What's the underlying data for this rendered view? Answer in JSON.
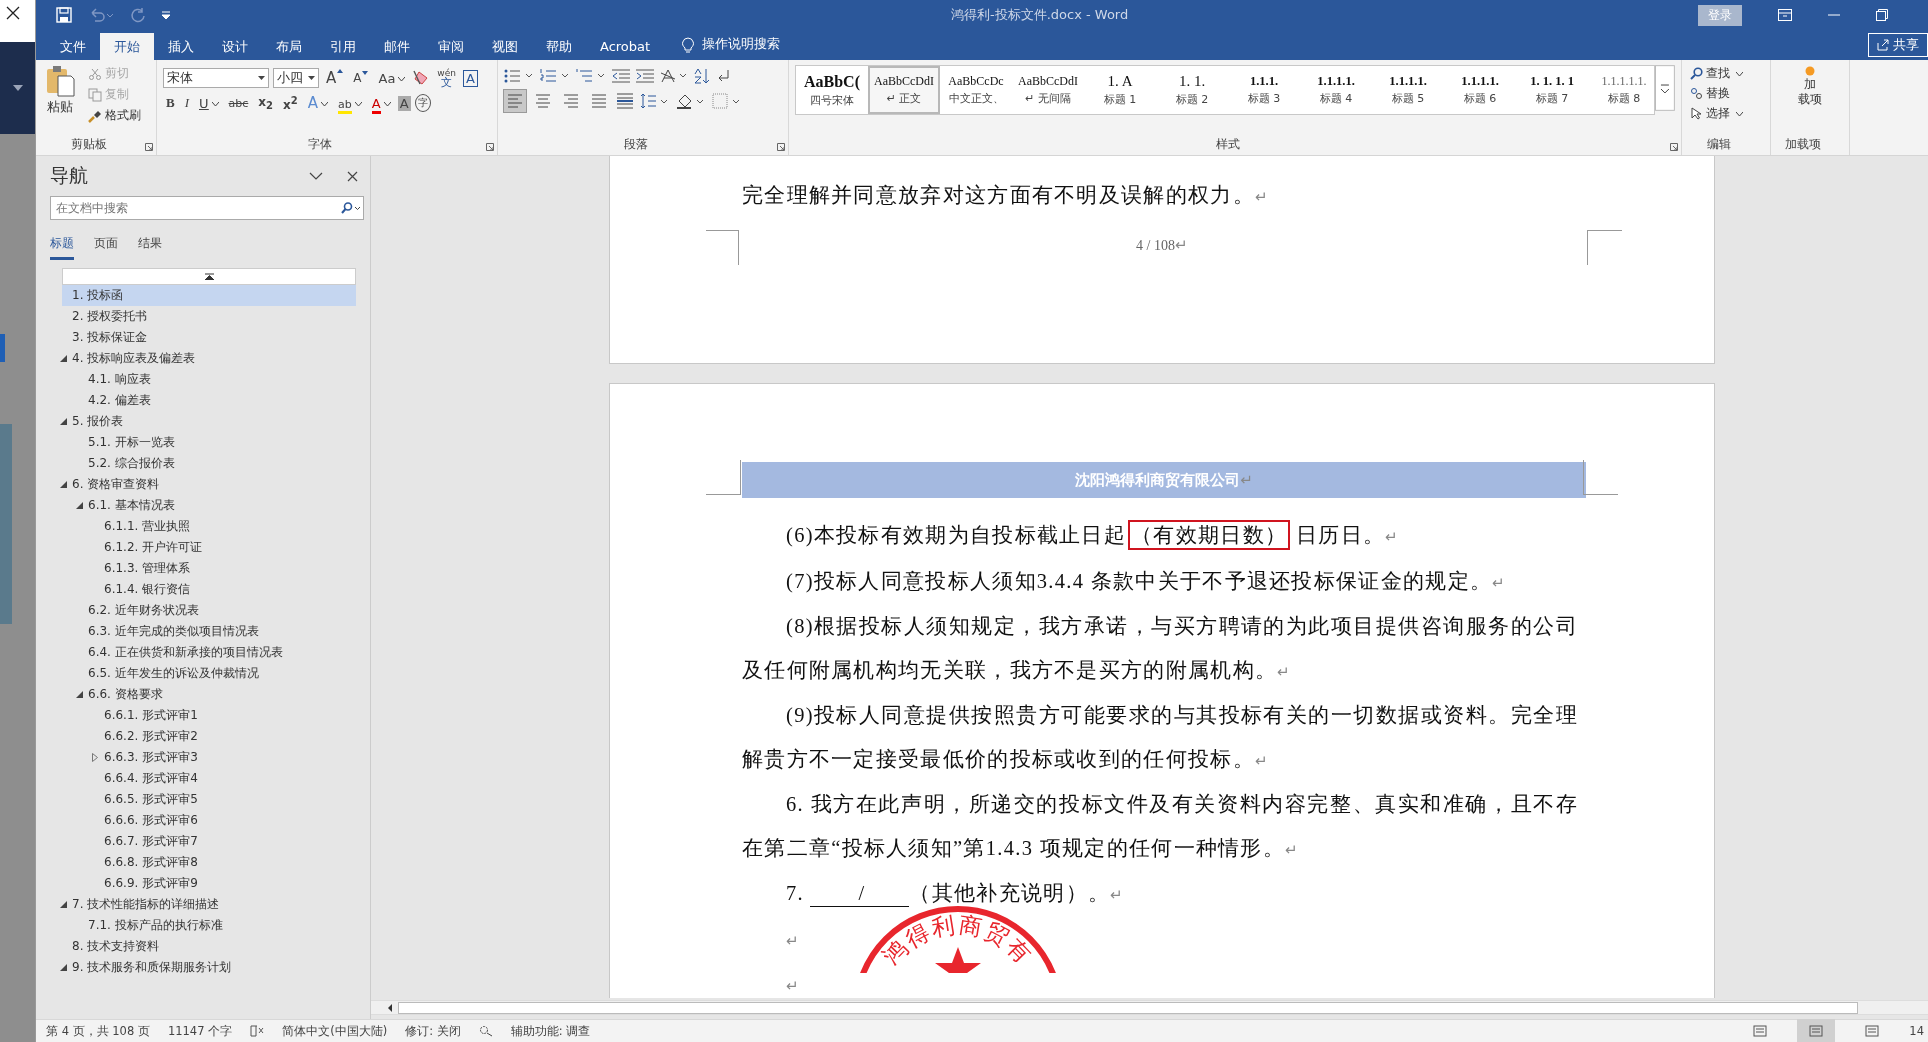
{
  "window": {
    "title": "鸿得利-投标文件.docx  -  Word",
    "sign_in": "登录",
    "share": "共享"
  },
  "ribbon_tabs": [
    {
      "label": "文件",
      "selected": false
    },
    {
      "label": "开始",
      "selected": true
    },
    {
      "label": "插入",
      "selected": false
    },
    {
      "label": "设计",
      "selected": false
    },
    {
      "label": "布局",
      "selected": false
    },
    {
      "label": "引用",
      "selected": false
    },
    {
      "label": "邮件",
      "selected": false
    },
    {
      "label": "审阅",
      "selected": false
    },
    {
      "label": "视图",
      "selected": false
    },
    {
      "label": "帮助",
      "selected": false
    },
    {
      "label": "Acrobat",
      "selected": false
    }
  ],
  "tell_me": "操作说明搜索",
  "clipboard": {
    "label": "剪贴板",
    "paste": "粘贴",
    "cut": {
      "label": "剪切",
      "disabled": true
    },
    "copy": {
      "label": "复制",
      "disabled": true
    },
    "format_painter": {
      "label": "格式刷",
      "disabled": false
    }
  },
  "font": {
    "label": "字体",
    "name": "宋体",
    "size": "小四",
    "tools": [
      {
        "kind": "grow",
        "label": "A"
      },
      {
        "kind": "shrink",
        "label": "A"
      },
      {
        "kind": "case",
        "label": "Aa"
      },
      {
        "kind": "clear"
      },
      {
        "kind": "phonetic",
        "top": "wén",
        "label": "文"
      },
      {
        "kind": "border",
        "label": "A"
      }
    ],
    "format": [
      {
        "kind": "bold",
        "label": "B"
      },
      {
        "kind": "italic",
        "label": "I"
      },
      {
        "kind": "underline",
        "label": "U"
      },
      {
        "kind": "strike",
        "label": "abc"
      },
      {
        "kind": "sub",
        "label": "x$_{2}$"
      },
      {
        "kind": "sup",
        "label": "x$^{2}$"
      },
      {
        "kind": "effects",
        "label": "A"
      },
      {
        "kind": "highlight",
        "label": "ab"
      },
      {
        "kind": "color",
        "label": "A"
      },
      {
        "kind": "shading",
        "label": "A"
      },
      {
        "kind": "enclose",
        "label": "字"
      }
    ]
  },
  "paragraph": {
    "label": "段落",
    "alignments": [
      {
        "selected": true
      },
      {
        "selected": false
      },
      {
        "selected": false
      },
      {
        "selected": false
      }
    ]
  },
  "styles": {
    "label": "样式",
    "items": [
      {
        "preview": "AaBbC(",
        "name": "四号宋体",
        "selected": false
      },
      {
        "preview": "AaBbCcDdI",
        "name": "↵ 正文",
        "selected": true
      },
      {
        "preview": "AaBbCcDc",
        "name": "中文正文、",
        "selected": false
      },
      {
        "preview": "AaBbCcDdI",
        "name": "↵ 无间隔",
        "selected": false
      },
      {
        "preview": "1.    A",
        "name": "标题 1",
        "selected": false
      },
      {
        "preview": "1. 1.",
        "name": "标题 2",
        "selected": false
      },
      {
        "preview": "1.1.1.",
        "name": "标题 3",
        "selected": false
      },
      {
        "preview": "1.1.1.1.",
        "name": "标题 4",
        "selected": false
      },
      {
        "preview": "1.1.1.1.",
        "name": "标题 5",
        "selected": false
      },
      {
        "preview": "1.1.1.1.",
        "name": "标题 6",
        "selected": false
      },
      {
        "preview": "1. 1. 1. 1",
        "name": "标题 7",
        "selected": false
      },
      {
        "preview": "1.1.1.1.1.",
        "name": "标题 8",
        "selected": false
      }
    ]
  },
  "editing": {
    "label": "编辑",
    "find": "查找",
    "replace": "替换",
    "select": "选择"
  },
  "addins": {
    "label": "加载项",
    "button_lines": [
      "加",
      "载项"
    ]
  },
  "nav": {
    "title": "导航",
    "search_placeholder": "在文档中搜索",
    "tabs": [
      {
        "label": "标题",
        "selected": true
      },
      {
        "label": "页面",
        "selected": false
      },
      {
        "label": "结果",
        "selected": false
      }
    ],
    "tree": [
      {
        "label": "1. 投标函",
        "selected": true
      },
      {
        "label": "2. 授权委托书",
        "selected": false
      },
      {
        "label": "3. 投标保证金",
        "selected": false
      },
      {
        "label": "4. 投标响应表及偏差表",
        "selected": false,
        "expanded": true,
        "children": [
          {
            "label": "4.1. 响应表",
            "selected": false
          },
          {
            "label": "4.2. 偏差表",
            "selected": false
          }
        ]
      },
      {
        "label": "5. 报价表",
        "selected": false,
        "expanded": true,
        "children": [
          {
            "label": "5.1. 开标一览表",
            "selected": false
          },
          {
            "label": "5.2. 综合报价表",
            "selected": false
          }
        ]
      },
      {
        "label": "6. 资格审查资料",
        "selected": false,
        "expanded": true,
        "children": [
          {
            "label": "6.1. 基本情况表",
            "selected": false,
            "expanded": true,
            "children": [
              {
                "label": "6.1.1. 营业执照",
                "selected": false
              },
              {
                "label": "6.1.2. 开户许可证",
                "selected": false
              },
              {
                "label": "6.1.3. 管理体系",
                "selected": false
              },
              {
                "label": "6.1.4. 银行资信",
                "selected": false
              }
            ]
          },
          {
            "label": "6.2. 近年财务状况表",
            "selected": false
          },
          {
            "label": "6.3. 近年完成的类似项目情况表",
            "selected": false
          },
          {
            "label": "6.4. 正在供货和新承接的项目情况表",
            "selected": false
          },
          {
            "label": "6.5. 近年发生的诉讼及仲裁情况",
            "selected": false
          },
          {
            "label": "6.6. 资格要求",
            "selected": false,
            "expanded": true,
            "children": [
              {
                "label": "6.6.1. 形式评审1",
                "selected": false
              },
              {
                "label": "6.6.2. 形式评审2",
                "selected": false
              },
              {
                "label": "6.6.3. 形式评审3",
                "selected": false,
                "expanded": false
              },
              {
                "label": "6.6.4. 形式评审4",
                "selected": false
              },
              {
                "label": "6.6.5. 形式评审5",
                "selected": false
              },
              {
                "label": "6.6.6. 形式评审6",
                "selected": false
              },
              {
                "label": "6.6.7. 形式评审7",
                "selected": false
              },
              {
                "label": "6.6.8. 形式评审8",
                "selected": false
              },
              {
                "label": "6.6.9. 形式评审9",
                "selected": false
              }
            ]
          }
        ]
      },
      {
        "label": "7. 技术性能指标的详细描述",
        "selected": false,
        "expanded": true,
        "children": [
          {
            "label": "7.1. 投标产品的执行标准",
            "selected": false
          }
        ]
      },
      {
        "label": "8. 技术支持资料",
        "selected": false
      },
      {
        "label": "9. 技术服务和质保期服务计划",
        "selected": false,
        "expanded": true
      }
    ]
  },
  "document": {
    "page_end": {
      "paragraphs": [
        {
          "indent": false,
          "mark": "↵",
          "segments": [
            {
              "kind": "text",
              "text": "完全理解并同意放弃对这方面有不明及误解的权力。"
            }
          ]
        }
      ],
      "footer": "4 / 108",
      "footer_mark": "↵"
    },
    "page": {
      "header": "沈阳鸿得利商贸有限公司",
      "header_mark": "↵",
      "paragraphs": [
        {
          "indent": true,
          "mark": "↵",
          "segments": [
            {
              "kind": "text",
              "text": "(6)本投标有效期为自投标截止日起"
            },
            {
              "kind": "boxed",
              "text": "（有效期日数）"
            },
            {
              "kind": "text",
              "text": "日历日。"
            }
          ]
        },
        {
          "indent": true,
          "mark": "↵",
          "segments": [
            {
              "kind": "text",
              "text": "(7)投标人同意投标人须知3.4.4 条款中关于不予退还投标保证金的规定。"
            }
          ]
        },
        {
          "indent": true,
          "mark": "↵",
          "segments": [
            {
              "kind": "text",
              "text": "(8)根据投标人须知规定，我方承诺，与买方聘请的为此项目提供咨询服务的公司及任何附属机构均无关联，我方不是买方的附属机构。"
            }
          ]
        },
        {
          "indent": true,
          "mark": "↵",
          "segments": [
            {
              "kind": "text",
              "text": "(9)投标人同意提供按照贵方可能要求的与其投标有关的一切数据或资料。完全理解贵方不一定接受最低价的投标或收到的任何投标。"
            }
          ]
        },
        {
          "indent": true,
          "mark": "↵",
          "segments": [
            {
              "kind": "text",
              "text": "6. 我方在此声明，所递交的投标文件及有关资料内容完整、真实和准确，且不存在第二章“投标人须知”第1.4.3 项规定的任何一种情形。"
            }
          ]
        },
        {
          "indent": true,
          "mark": "↵",
          "segments": [
            {
              "kind": "text",
              "text": "7. "
            },
            {
              "kind": "blank",
              "text": "/"
            },
            {
              "kind": "text",
              "text": "（其他补充说明）。"
            }
          ]
        },
        {
          "indent": true,
          "mark": "↵"
        },
        {
          "indent": true,
          "mark": "↵"
        }
      ],
      "stamp": {
        "text": "鸿得利商贸有"
      }
    }
  },
  "status_bar": {
    "page": "第 4 页，共 108 页",
    "words": "11147 个字",
    "language": "简体中文(中国大陆)",
    "track_changes": "修订: 关闭",
    "accessibility": "辅助功能: 调查",
    "zoom": "14"
  },
  "view_modes": [
    {
      "selected": false
    },
    {
      "selected": true
    },
    {
      "selected": false
    }
  ]
}
